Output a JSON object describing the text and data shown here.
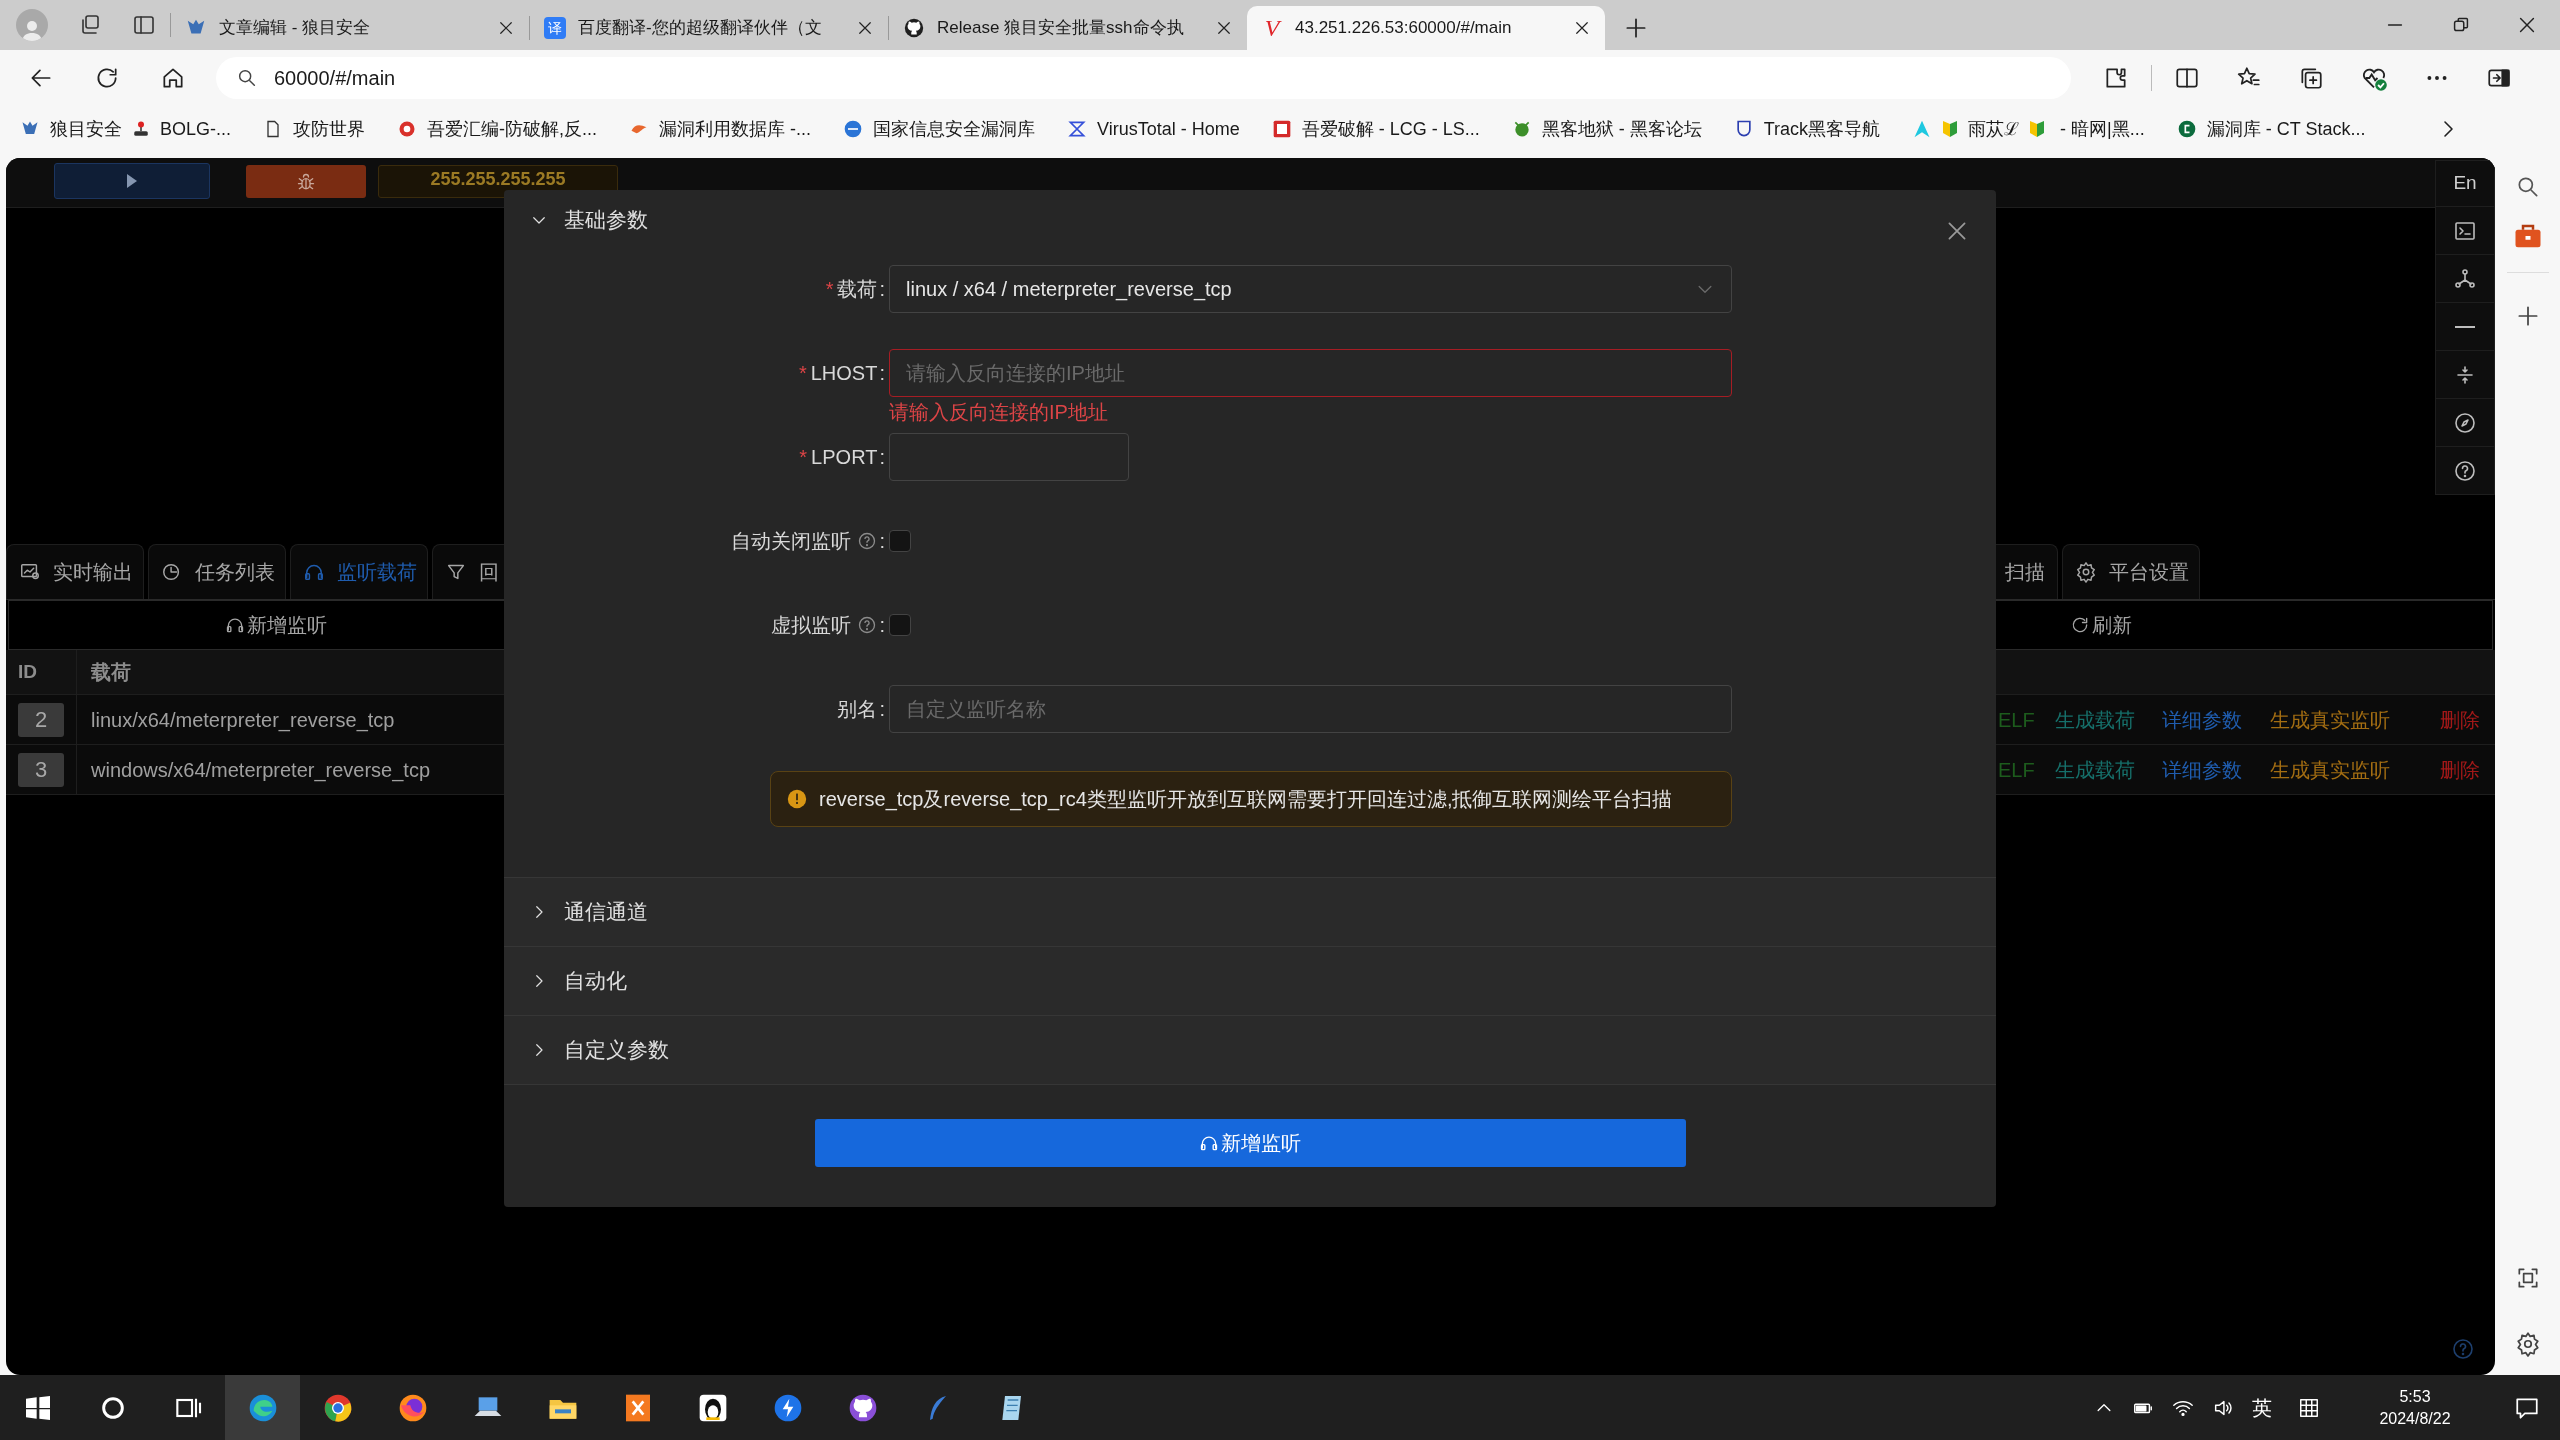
{
  "browser": {
    "tabs": [
      {
        "title": "文章编辑 - 狼目安全",
        "selected": false
      },
      {
        "title": "百度翻译-您的超级翻译伙伴（文",
        "icon_text": "译",
        "selected": false
      },
      {
        "title": "Release 狼目安全批量ssh命令执",
        "selected": false
      },
      {
        "title": "43.251.226.53:60000/#/main",
        "icon_text": "V",
        "selected": true
      }
    ],
    "address": "60000/#/main",
    "bookmarks": [
      {
        "segments": [
          "狼目安全",
          "BOLG-..."
        ]
      },
      {
        "segments": [
          "攻防世界"
        ]
      },
      {
        "segments": [
          "吾爱汇编-防破解,反..."
        ]
      },
      {
        "segments": [
          "漏洞利用数据库 -..."
        ]
      },
      {
        "segments": [
          "国家信息安全漏洞库"
        ]
      },
      {
        "segments": [
          "VirusTotal - Home"
        ]
      },
      {
        "segments": [
          "吾爱破解 - LCG - LS..."
        ]
      },
      {
        "segments": [
          "黑客地狱 - 黑客论坛"
        ]
      },
      {
        "segments": [
          "Track黑客导航"
        ]
      },
      {
        "segments": [
          "雨苁ℒ",
          " - 暗网|黑..."
        ]
      },
      {
        "segments": [
          "漏洞库 - CT Stack..."
        ]
      }
    ]
  },
  "app": {
    "ip": "255.255.255.255",
    "language_button": "En",
    "tabs_left": [
      {
        "label": "实时输出",
        "selected": false
      },
      {
        "label": "任务列表",
        "selected": false
      },
      {
        "label": "监听载荷",
        "selected": true
      },
      {
        "label": "回",
        "selected": false
      }
    ],
    "tabs_right": [
      {
        "label": "扫描",
        "selected": false
      },
      {
        "label": "平台设置",
        "selected": false
      }
    ],
    "add_button": "新增监听",
    "refresh_button": "刷新",
    "table": {
      "columns": [
        "ID",
        "载荷"
      ],
      "rows": [
        {
          "id": "2",
          "payload": "linux/x64/meterpreter_reverse_tcp",
          "actions": [
            {
              "label": "ELF",
              "color": "#1d5c1d"
            },
            {
              "label": "生成载荷",
              "color": "#16706b"
            },
            {
              "label": "详细参数",
              "color": "#1f5cae"
            },
            {
              "label": "生成真实监听",
              "color": "#a36d12"
            },
            {
              "label": "删除",
              "color": "#a31818"
            }
          ]
        },
        {
          "id": "3",
          "payload": "windows/x64/meterpreter_reverse_tcp",
          "actions": [
            {
              "label": "ELF",
              "color": "#1d5c1d"
            },
            {
              "label": "生成载荷",
              "color": "#16706b"
            },
            {
              "label": "详细参数",
              "color": "#1f5cae"
            },
            {
              "label": "生成真实监听",
              "color": "#a36d12"
            },
            {
              "label": "删除",
              "color": "#a31818"
            }
          ]
        }
      ]
    }
  },
  "modal": {
    "section": {
      "title": "基础参数",
      "expanded": true
    },
    "fields": [
      {
        "kind": "select",
        "required_mark": "*",
        "label": "载荷",
        "suffix": ":",
        "value": "linux / x64 / meterpreter_reverse_tcp"
      },
      {
        "kind": "input",
        "required_mark": "*",
        "label": "LHOST",
        "suffix": ":",
        "placeholder": "请输入反向连接的IP地址",
        "error": "请输入反向连接的IP地址"
      },
      {
        "kind": "short_input",
        "required_mark": "*",
        "label": "LPORT",
        "suffix": ":"
      },
      {
        "kind": "checkbox",
        "label": "自动关闭监听",
        "help": true,
        "suffix": ":",
        "checked": false
      },
      {
        "kind": "checkbox",
        "label": "虚拟监听",
        "help": true,
        "suffix": ":",
        "checked": false
      },
      {
        "kind": "input",
        "label": "别名",
        "suffix": ":",
        "placeholder": "自定义监听名称"
      }
    ],
    "alert": "reverse_tcp及reverse_tcp_rc4类型监听开放到互联网需要打开回连过滤,抵御互联网测绘平台扫描",
    "panels": [
      {
        "title": "通信通道",
        "expanded": false
      },
      {
        "title": "自动化",
        "expanded": false
      },
      {
        "title": "自定义参数",
        "expanded": false
      }
    ],
    "submit": "新增监听"
  },
  "taskbar": {
    "apps": [
      {
        "selected": true
      },
      {
        "selected": false
      },
      {
        "selected": false
      },
      {
        "selected": false
      },
      {
        "selected": false
      },
      {
        "selected": false
      },
      {
        "selected": false
      },
      {
        "selected": false
      },
      {
        "selected": false
      },
      {
        "selected": false
      },
      {
        "selected": false
      }
    ],
    "ime": "英",
    "time": "5:53",
    "date": "2024/8/22"
  }
}
